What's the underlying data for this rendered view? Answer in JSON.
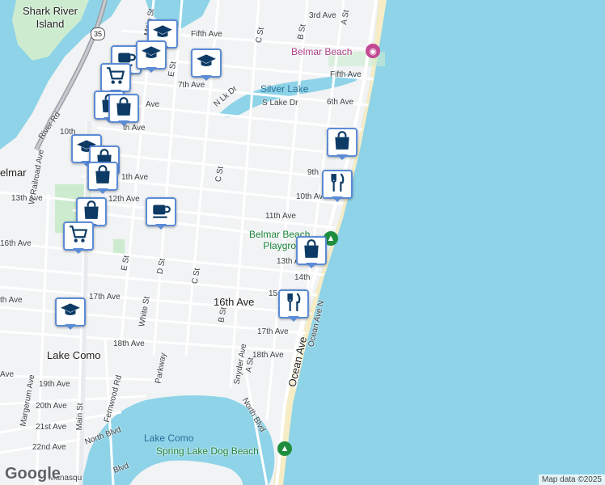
{
  "map": {
    "places": {
      "shark_river_island": "Shark River\nIsland",
      "belmar_beach": "Belmar Beach",
      "silver_lake": "Silver Lake",
      "belmar": "elmar",
      "lake_como_town": "Lake Como",
      "lake_como_water": "Lake Como",
      "belmar_beach_playground": "Belmar Beach\nPlaygro",
      "spring_lake_dog_beach": "Spring Lake Dog Beach"
    },
    "streets": {
      "3rd_ave": "3rd Ave",
      "a_st_n": "A St",
      "b_st_n": "B St",
      "c_st_n": "C St",
      "fifth_ave_w": "Fifth Ave",
      "fifth_ave_e": "Fifth Ave",
      "e_st_n": "E St",
      "main_st_n": "Main St",
      "7th_ave": "7th Ave",
      "n_lk_dr": "N Lk Dr",
      "s_lake_dr": "S Lake Dr",
      "6th_ave": "6th Ave",
      "ave_partial": "Ave",
      "river_rd": "River Rd",
      "10th_partial": "10th",
      "th_ave_partial": "th Ave",
      "11th_ave_w": "1th Ave",
      "9th_partial": "9th",
      "10th_ave": "10th Ave",
      "c_st_mid": "C St",
      "13th_ave_w": "13th Ave",
      "12th_ave": "12th Ave",
      "11th_ave": "11th Ave",
      "16th_ave_w": "16th Ave",
      "w_railroad_ave": "W Railroad Ave",
      "e_st": "E St",
      "d_st": "D St",
      "c_st": "C St",
      "13th_ave": "13th Ave",
      "14th_partial": "14th",
      "15_partial": "15",
      "17th_ave_w": "17th Ave",
      "16th_ave": "16th Ave",
      "white_st": "White St",
      "b_st": "B St",
      "17th_ave": "17th Ave",
      "18th_ave_w": "18th Ave",
      "parkway": "Parkway",
      "snyder_ave": "Snyder Ave",
      "a_st": "A St",
      "18th_ave": "18th Ave",
      "ocean_ave": "Ocean Ave",
      "ocean_ave_n": "Ocean Ave N",
      "19th_ave": "19th Ave",
      "20th_ave": "20th Ave",
      "21st_ave": "21st Ave",
      "22nd_ave": "22nd Ave",
      "margerum_ave": "Margerum Ave",
      "fernwood_rd": "Fernwood Rd",
      "main_st": "Main St",
      "north_blvd": "North Blvd",
      "north_blvd_e": "North Blvd",
      "th_ave_left": "th Ave",
      "ave_left": "Ave",
      "blvd_bottom": "Blvd",
      "manasquan": "Manasqu"
    },
    "route_shield": "35",
    "colors": {
      "water": "#8ed3e8",
      "land": "#f1f3f4",
      "park": "#cdeccf",
      "sand": "#f6ecc6",
      "marker_border": "#5b8bd6",
      "marker_icon": "#0d3b66"
    },
    "markers": [
      {
        "icon": "graduation-cap-icon"
      },
      {
        "icon": "coffee-cup-icon"
      },
      {
        "icon": "graduation-cap-icon"
      },
      {
        "icon": "graduation-cap-icon"
      },
      {
        "icon": "shopping-cart-icon"
      },
      {
        "icon": "shopping-bag-icon"
      },
      {
        "icon": "shopping-bag-icon"
      },
      {
        "icon": "graduation-cap-icon"
      },
      {
        "icon": "shopping-bag-icon"
      },
      {
        "icon": "shopping-bag-icon"
      },
      {
        "icon": "coffee-cup-icon"
      },
      {
        "icon": "shopping-bag-icon"
      },
      {
        "icon": "shopping-cart-icon"
      },
      {
        "icon": "shopping-bag-icon"
      },
      {
        "icon": "fork-knife-icon"
      },
      {
        "icon": "shopping-bag-icon"
      },
      {
        "icon": "fork-knife-icon"
      },
      {
        "icon": "graduation-cap-icon"
      }
    ],
    "logo": "Google",
    "attribution": "Map data ©2025"
  }
}
